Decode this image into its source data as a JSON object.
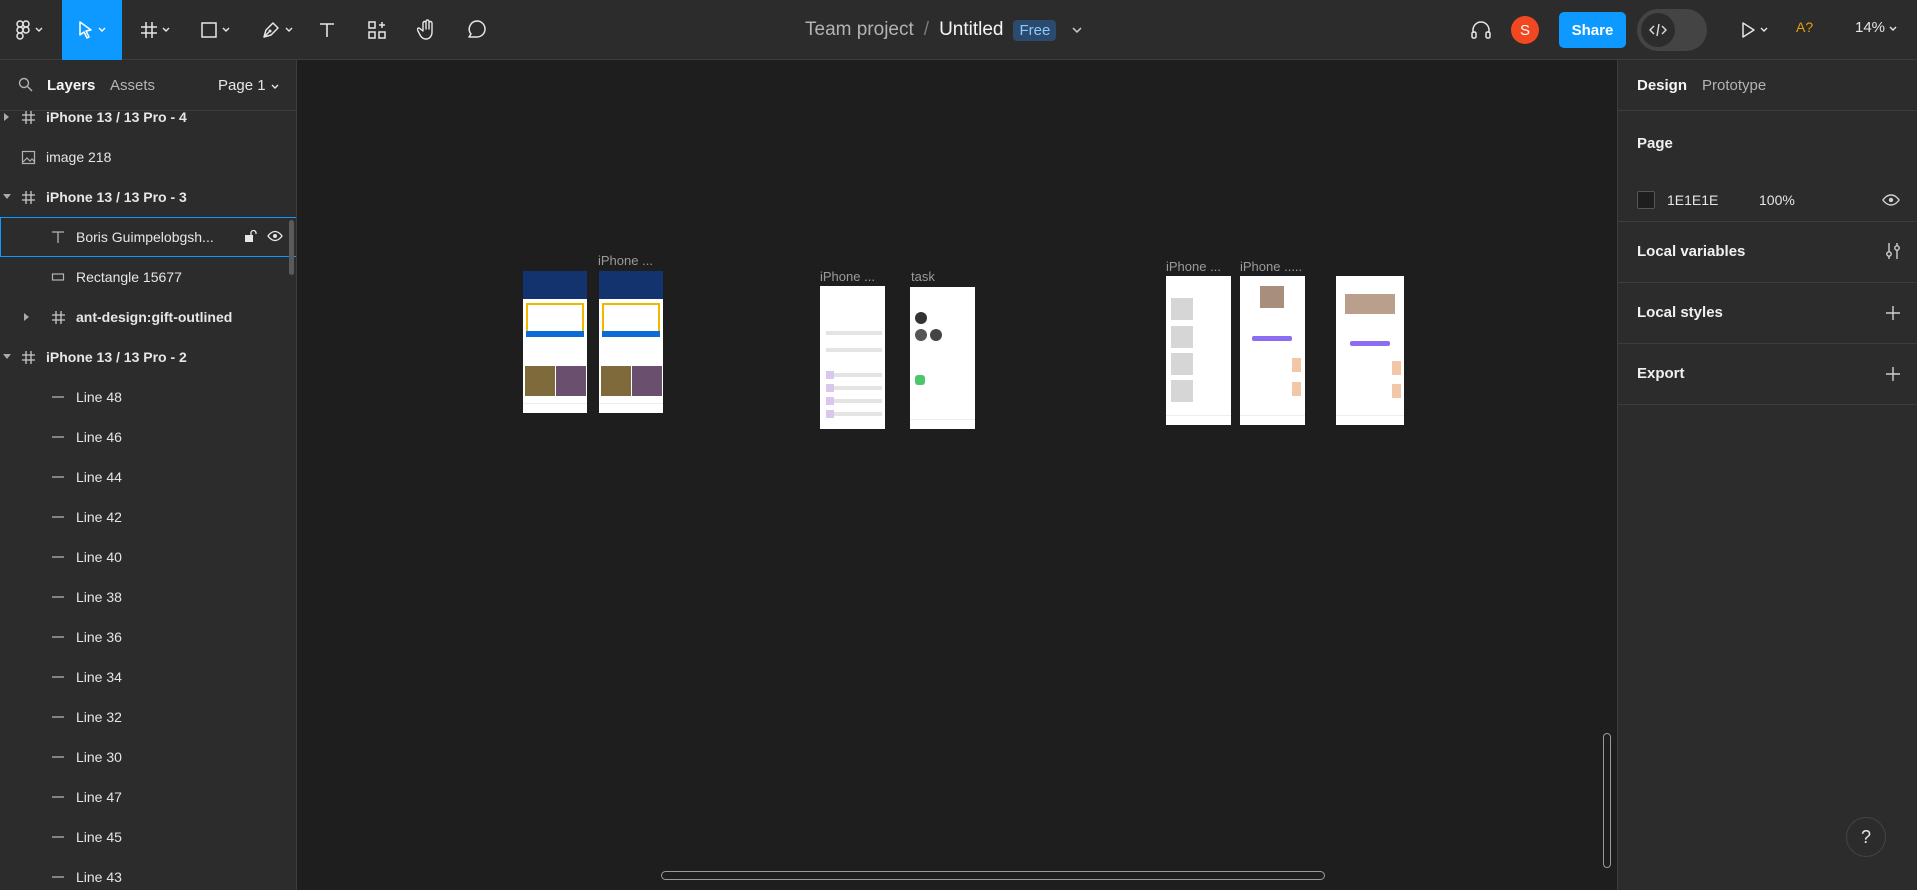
{
  "toolbar": {
    "tools": [
      "main-menu",
      "move",
      "frame",
      "shape",
      "pen",
      "text",
      "resources",
      "hand",
      "comment"
    ],
    "active_tool": "move"
  },
  "title": {
    "team": "Team project",
    "separator": "/",
    "file": "Untitled",
    "plan_badge": "Free"
  },
  "header_right": {
    "avatar_initial": "S",
    "share_label": "Share",
    "fonts_warning": "A?",
    "zoom": "14%"
  },
  "left_panel": {
    "tabs": [
      "Layers",
      "Assets"
    ],
    "active_tab": "Layers",
    "page_selector": "Page 1",
    "layers": [
      {
        "name": "iPhone 13 / 13 Pro - 4",
        "kind": "frame",
        "expand": "collapsed"
      },
      {
        "name": "image 218",
        "kind": "image",
        "expand": "none"
      },
      {
        "name": "iPhone 13 / 13 Pro - 3",
        "kind": "frame",
        "expand": "expanded"
      },
      {
        "name": "Boris Guimpelobgsh...",
        "kind": "text",
        "expand": "none",
        "selected": true
      },
      {
        "name": "Rectangle 15677",
        "kind": "rect",
        "expand": "none"
      },
      {
        "name": "ant-design:gift-outlined",
        "kind": "frame",
        "expand": "collapsed"
      },
      {
        "name": "iPhone 13 / 13 Pro - 2",
        "kind": "frame",
        "expand": "expanded"
      },
      {
        "name": "Line 48",
        "kind": "line"
      },
      {
        "name": "Line 46",
        "kind": "line"
      },
      {
        "name": "Line 44",
        "kind": "line"
      },
      {
        "name": "Line 42",
        "kind": "line"
      },
      {
        "name": "Line 40",
        "kind": "line"
      },
      {
        "name": "Line 38",
        "kind": "line"
      },
      {
        "name": "Line 36",
        "kind": "line"
      },
      {
        "name": "Line 34",
        "kind": "line"
      },
      {
        "name": "Line 32",
        "kind": "line"
      },
      {
        "name": "Line 30",
        "kind": "line"
      },
      {
        "name": "Line 47",
        "kind": "line"
      },
      {
        "name": "Line 45",
        "kind": "line"
      },
      {
        "name": "Line 43",
        "kind": "line"
      }
    ]
  },
  "canvas": {
    "background": "#1E1E1E",
    "frame_labels": [
      "iPhone ...",
      "iPhone ...",
      "task",
      "iPhone ...",
      "iPhone ....."
    ]
  },
  "right_panel": {
    "tabs": [
      "Design",
      "Prototype"
    ],
    "active_tab": "Design",
    "page_section": "Page",
    "page_color": "1E1E1E",
    "page_opacity": "100%",
    "sections": [
      "Local variables",
      "Local styles",
      "Export"
    ]
  },
  "help_label": "?",
  "colors": {
    "accent": "#0d99ff",
    "avatar": "#f24822",
    "panel": "#2c2c2c",
    "canvas": "#1e1e1e"
  }
}
